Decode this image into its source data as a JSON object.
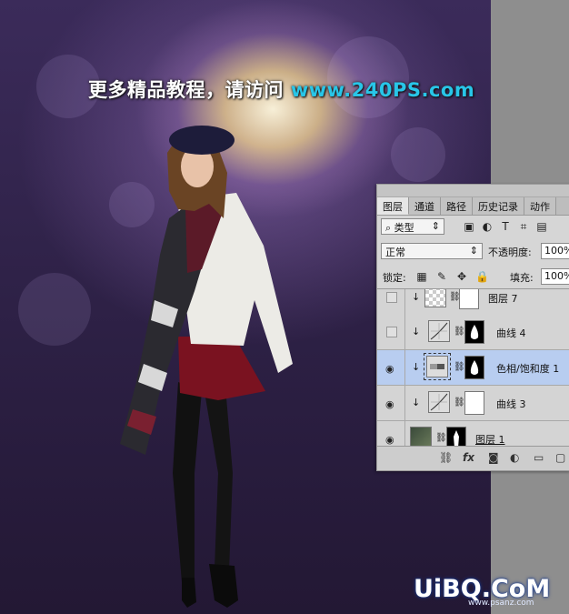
{
  "banner": {
    "text": "更多精品教程，请访问",
    "site": "www.240PS.com"
  },
  "watermark": {
    "main": "UiBQ.CoM",
    "sub": "www.psanz.com"
  },
  "layers_panel": {
    "tabs": [
      "图层",
      "通道",
      "路径",
      "历史记录",
      "动作"
    ],
    "active_tab": "图层",
    "filter_kind": "类型",
    "blend_mode": "正常",
    "opacity_label": "不透明度:",
    "opacity_value": "100%",
    "lock_label": "锁定:",
    "fill_label": "填充:",
    "fill_value": "100%",
    "layers": [
      {
        "name": "图层 7",
        "visible": false,
        "clipped": true,
        "selected": false
      },
      {
        "name": "曲线 4",
        "visible": false,
        "clipped": true,
        "selected": false
      },
      {
        "name": "色相/饱和度 1",
        "visible": true,
        "clipped": true,
        "selected": true
      },
      {
        "name": "曲线 3",
        "visible": true,
        "clipped": true,
        "selected": false
      },
      {
        "name": "图层 1",
        "visible": true,
        "clipped": false,
        "selected": false
      }
    ]
  },
  "icons": {
    "search": "search-icon",
    "eye": "eye-icon",
    "link": "link-icon",
    "fx": "fx-icon"
  },
  "colors": {
    "selected_layer": "#b8cdf0",
    "site_text": "#28c6e8"
  }
}
